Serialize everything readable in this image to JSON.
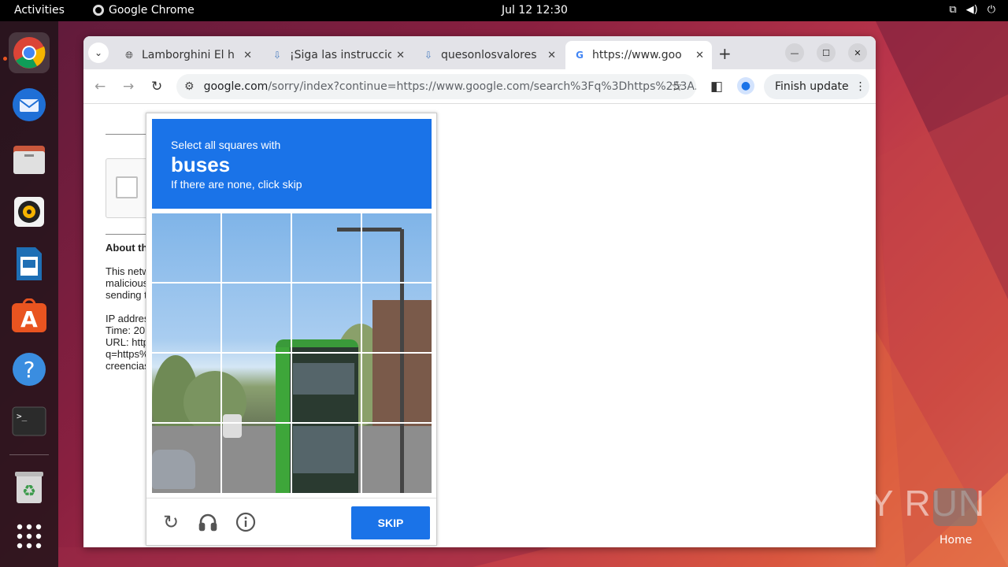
{
  "topbar": {
    "activities": "Activities",
    "app_name": "Google Chrome",
    "clock": "Jul 12  12:30",
    "tray": [
      "network-icon",
      "volume-icon",
      "power-icon"
    ]
  },
  "dock": {
    "items": [
      "chrome-icon",
      "thunderbird-icon",
      "files-icon",
      "rhythmbox-icon",
      "writer-icon",
      "app-center-icon",
      "help-icon",
      "terminal-icon",
      "trash-icon",
      "show-apps-icon"
    ]
  },
  "browser": {
    "tabs": [
      {
        "title": "Lamborghini El h",
        "favicon": "globe-icon",
        "close": "✕"
      },
      {
        "title": "¡Siga las instruccio",
        "favicon": "download-cloud-icon",
        "close": "✕"
      },
      {
        "title": "quesonlosvalores",
        "favicon": "download-cloud-icon",
        "close": "✕"
      },
      {
        "title": "https://www.goo",
        "favicon": "google-icon",
        "close": "✕",
        "active": true
      }
    ],
    "new_tab": "+",
    "url_host": "google.com",
    "url_path": "/sorry/index?continue=https://www.google.com/search%3Fq%3Dhttps%253A...",
    "finish_update": "Finish update",
    "menu_glyph": "⋮"
  },
  "page": {
    "about": "About th",
    "lines1": [
      "This netw",
      "malicious",
      "sending t"
    ],
    "lines2": [
      "IP addres",
      "Time: 20",
      "URL: http",
      "q=https%",
      "creencias"
    ]
  },
  "captcha": {
    "line1": "Select all squares with",
    "target": "buses",
    "line3": "If there are none, click skip",
    "skip_label": "SKIP",
    "grid_size": 4
  },
  "watermark": "ANY RUN",
  "home_label": "Home"
}
